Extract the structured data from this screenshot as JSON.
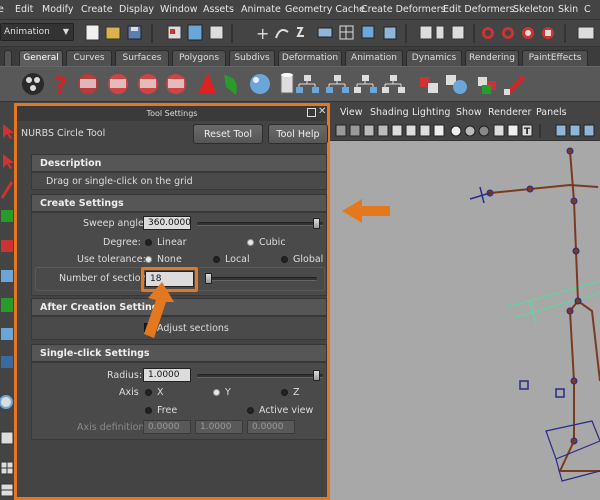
{
  "menubar": {
    "items": [
      "File",
      "Edit",
      "Modify",
      "Create",
      "Display",
      "Window",
      "Assets",
      "Animate",
      "Geometry Cache",
      "Create Deformers",
      "Edit Deformers",
      "Skeleton",
      "Skin",
      "Constrain"
    ],
    "visible_items": [
      "Edit",
      "Modify",
      "Create",
      "Display",
      "Window",
      "Assets",
      "Animate",
      "Geometry Cache",
      "Create Deformers",
      "Edit Deformers",
      "Skeleton",
      "Skin"
    ]
  },
  "toolbar": {
    "mode_menu": "Animation"
  },
  "shelf": {
    "tabs": [
      "General",
      "Curves",
      "Surfaces",
      "Polygons",
      "Subdivs",
      "Deformation",
      "Animation",
      "Dynamics",
      "Rendering",
      "PaintEffects"
    ],
    "active_tab": "General"
  },
  "tool_settings": {
    "window_title": "Tool Settings",
    "tool_name": "NURBS Circle Tool",
    "reset_button": "Reset Tool",
    "help_button": "Tool Help",
    "description": {
      "header": "Description",
      "text": "Drag or single-click on the grid"
    },
    "create_settings": {
      "header": "Create Settings",
      "sweep_label": "Sweep angle:",
      "sweep_value": "360.0000",
      "degree_label": "Degree:",
      "degree_options": [
        "Linear",
        "Cubic"
      ],
      "degree_selected": "Cubic",
      "tolerance_label": "Use tolerance:",
      "tolerance_options": [
        "None",
        "Local",
        "Global"
      ],
      "tolerance_selected": "None",
      "sections_label": "Number of sections:",
      "sections_value": "18"
    },
    "after_creation": {
      "header": "After Creation Settings",
      "adjust_label": "Adjust sections"
    },
    "single_click": {
      "header": "Single-click Settings",
      "radius_label": "Radius:",
      "radius_value": "1.0000",
      "axis_label": "Axis",
      "axis_options": [
        "X",
        "Y",
        "Z",
        "Free",
        "Active view"
      ],
      "axis_selected": "Y",
      "axis_def_label": "Axis definition:",
      "axis_def_values": [
        "0.0000",
        "1.0000",
        "0.0000"
      ]
    }
  },
  "viewport": {
    "menu": [
      "View",
      "Shading",
      "Lighting",
      "Show",
      "Renderer",
      "Panels"
    ]
  },
  "colors": {
    "highlight": "#e3781f",
    "panel_bg": "#444444",
    "viewport_bg": "#a8a8a8",
    "skeleton": "#7a3a20",
    "wire": "#2a2a8a",
    "grid_green": "#4fe0a0"
  }
}
